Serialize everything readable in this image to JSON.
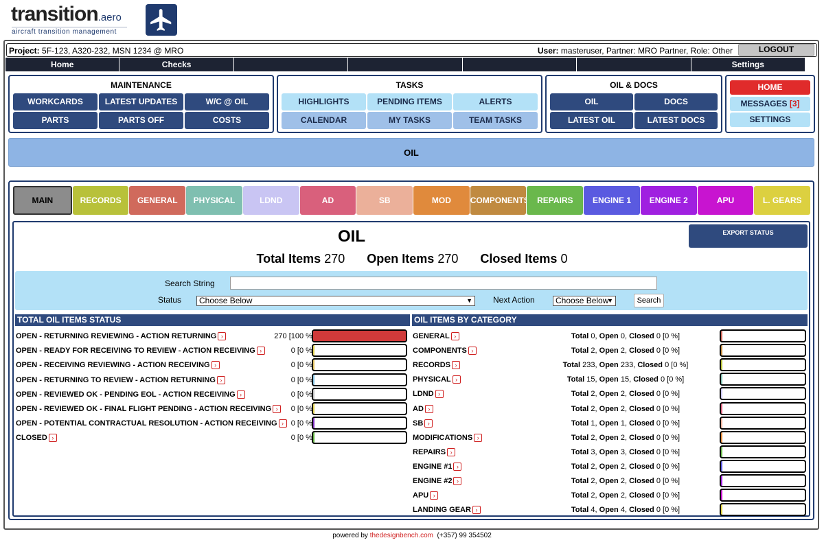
{
  "logo": {
    "name": "transition",
    "suffix": ".aero",
    "tagline": "aircraft transition management",
    "icon": "airplane-icon"
  },
  "topbar": {
    "project_label": "Project:",
    "project_value": "5F-123, A320-232, MSN 1234 @ MRO",
    "user_label": "User:",
    "user_value": "masteruser, Partner: MRO Partner, Role: Other",
    "logout": "LOGOUT"
  },
  "navbar": [
    "Home",
    "Checks",
    "",
    "",
    "",
    "",
    "Settings"
  ],
  "groups": {
    "maintenance": {
      "title": "MAINTENANCE",
      "buttons": [
        "WORKCARDS",
        "LATEST UPDATES",
        "W/C @ OIL",
        "PARTS",
        "PARTS OFF",
        "COSTS"
      ]
    },
    "tasks": {
      "title": "TASKS",
      "buttons": [
        "HIGHLIGHTS",
        "PENDING ITEMS",
        "ALERTS",
        "CALENDAR",
        "MY TASKS",
        "TEAM TASKS"
      ]
    },
    "oil_docs": {
      "title": "OIL & DOCS",
      "buttons": [
        "OIL",
        "DOCS",
        "LATEST OIL",
        "LATEST DOCS"
      ]
    },
    "side": {
      "home": "HOME",
      "messages": "MESSAGES",
      "messages_count": "[3]",
      "settings": "SETTINGS"
    }
  },
  "section_banner": "OIL",
  "tabs": [
    {
      "label": "MAIN",
      "color": "#8c8c8c"
    },
    {
      "label": "RECORDS",
      "color": "#b8c13a"
    },
    {
      "label": "GENERAL",
      "color": "#d06a5c"
    },
    {
      "label": "PHYSICAL",
      "color": "#7fbfb0"
    },
    {
      "label": "LDND",
      "color": "#c9c5f3"
    },
    {
      "label": "AD",
      "color": "#d9607c"
    },
    {
      "label": "SB",
      "color": "#ebb09a"
    },
    {
      "label": "MOD",
      "color": "#e08a3c"
    },
    {
      "label": "COMPONENTS",
      "color": "#c08a40"
    },
    {
      "label": "REPAIRS",
      "color": "#6ab84c"
    },
    {
      "label": "ENGINE 1",
      "color": "#5a5ae0"
    },
    {
      "label": "ENGINE 2",
      "color": "#a020e0"
    },
    {
      "label": "APU",
      "color": "#c814d0"
    },
    {
      "label": "L. GEARS",
      "color": "#dcd040"
    }
  ],
  "page": {
    "title": "OIL",
    "export_button": "EXPORT STATUS",
    "total_label": "Total Items",
    "total_value": "270",
    "open_label": "Open Items",
    "open_value": "270",
    "closed_label": "Closed Items",
    "closed_value": "0"
  },
  "search": {
    "string_label": "Search String",
    "status_label": "Status",
    "status_value": "Choose Below",
    "next_action_label": "Next Action",
    "next_action_value": "Choose Below",
    "button": "Search"
  },
  "status_section": {
    "title": "TOTAL OIL ITEMS STATUS",
    "rows": [
      {
        "label": "OPEN - RETURNING REVIEWING - ACTION RETURNING",
        "value": "270 [100 %]",
        "fill": 1.0,
        "color": "#d03a3a"
      },
      {
        "label": "OPEN - READY FOR RECEIVING TO REVIEW - ACTION RECEIVING",
        "value": "0 [0 %]",
        "fill": 0,
        "color": "#e0d050"
      },
      {
        "label": "OPEN - RECEIVING REVIEWING - ACTION RECEIVING",
        "value": "0 [0 %]",
        "fill": 0,
        "color": "#e0c060"
      },
      {
        "label": "OPEN - RETURNING TO REVIEW - ACTION RETURNING",
        "value": "0 [0 %]",
        "fill": 0,
        "color": "#80c0e0"
      },
      {
        "label": "OPEN - REVIEWED OK - PENDING EOL - ACTION RECEIVING",
        "value": "0 [0 %]",
        "fill": 0,
        "color": "#c0c0c0"
      },
      {
        "label": "OPEN - REVIEWED OK - FINAL FLIGHT PENDING - ACTION RECEIVING",
        "value": "0 [0 %]",
        "fill": 0,
        "color": "#e0d050"
      },
      {
        "label": "OPEN - POTENTIAL CONTRACTUAL RESOLUTION - ACTION RECEIVING",
        "value": "0 [0 %]",
        "fill": 0,
        "color": "#8030c0"
      },
      {
        "label": "CLOSED",
        "value": "0 [0 %]",
        "fill": 0,
        "color": "#60b040"
      }
    ]
  },
  "category_section": {
    "title": "OIL ITEMS BY CATEGORY",
    "rows": [
      {
        "label": "GENERAL",
        "total": "0",
        "open": "0",
        "closed": "0",
        "pct": "[0 %]",
        "color": "#d06a5c"
      },
      {
        "label": "COMPONENTS",
        "total": "2",
        "open": "2",
        "closed": "0",
        "pct": "[0 %]",
        "color": "#c08a40"
      },
      {
        "label": "RECORDS",
        "total": "233",
        "open": "233",
        "closed": "0",
        "pct": "[0 %]",
        "color": "#b8c13a"
      },
      {
        "label": "PHYSICAL",
        "total": "15",
        "open": "15",
        "closed": "0",
        "pct": "[0 %]",
        "color": "#7fbfb0"
      },
      {
        "label": "LDND",
        "total": "2",
        "open": "2",
        "closed": "0",
        "pct": "[0 %]",
        "color": "#c9c5f3"
      },
      {
        "label": "AD",
        "total": "2",
        "open": "2",
        "closed": "0",
        "pct": "[0 %]",
        "color": "#d9607c"
      },
      {
        "label": "SB",
        "total": "1",
        "open": "1",
        "closed": "0",
        "pct": "[0 %]",
        "color": "#ebb09a"
      },
      {
        "label": "MODIFICATIONS",
        "total": "2",
        "open": "2",
        "closed": "0",
        "pct": "[0 %]",
        "color": "#e08a3c"
      },
      {
        "label": "REPAIRS",
        "total": "3",
        "open": "3",
        "closed": "0",
        "pct": "[0 %]",
        "color": "#6ab84c"
      },
      {
        "label": "ENGINE #1",
        "total": "2",
        "open": "2",
        "closed": "0",
        "pct": "[0 %]",
        "color": "#5a5ae0"
      },
      {
        "label": "ENGINE #2",
        "total": "2",
        "open": "2",
        "closed": "0",
        "pct": "[0 %]",
        "color": "#a020e0"
      },
      {
        "label": "APU",
        "total": "2",
        "open": "2",
        "closed": "0",
        "pct": "[0 %]",
        "color": "#c814d0"
      },
      {
        "label": "LANDING GEAR",
        "total": "4",
        "open": "4",
        "closed": "0",
        "pct": "[0 %]",
        "color": "#dcd040"
      }
    ]
  },
  "footer": {
    "prefix": "powered by",
    "link": "thedesignbench.com",
    "phone": "(+357) 99 354502"
  }
}
